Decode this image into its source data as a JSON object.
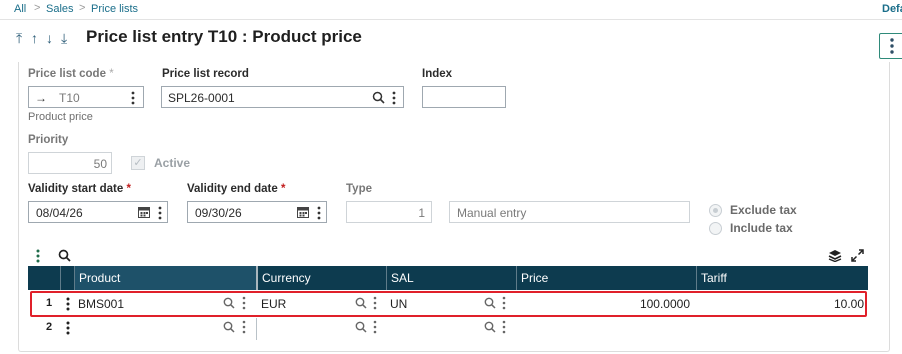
{
  "breadcrumb": {
    "items": [
      "All",
      "Sales",
      "Price lists"
    ],
    "separator": ">",
    "right_label": "Default"
  },
  "header": {
    "title": "Price list entry T10 : Product price",
    "nav": [
      "⤒",
      "↑",
      "↓",
      "⤓"
    ],
    "actions_icon": "kebab-icon"
  },
  "form": {
    "price_list_code": {
      "label": "Price list code",
      "value": "T10",
      "arrow": "→",
      "description": "Product price"
    },
    "price_list_record": {
      "label": "Price list record",
      "value": "SPL26-0001"
    },
    "index": {
      "label": "Index",
      "value": ""
    },
    "priority": {
      "label": "Priority",
      "value": "50"
    },
    "active": {
      "label": "Active",
      "checked": true
    },
    "validity_start": {
      "label": "Validity start date",
      "value": "08/04/26"
    },
    "validity_end": {
      "label": "Validity end date",
      "value": "09/30/26"
    },
    "type": {
      "label": "Type",
      "value": "1",
      "description": "Manual entry"
    },
    "tax": {
      "options": [
        "Exclude tax",
        "Include tax"
      ],
      "selected": "Exclude tax"
    }
  },
  "grid": {
    "columns": [
      "Product",
      "Currency",
      "SAL",
      "Price",
      "Tariff"
    ],
    "rows": [
      {
        "num": "1",
        "product": "BMS001",
        "currency": "EUR",
        "sal": "UN",
        "price": "100.0000",
        "tariff": "10.00"
      },
      {
        "num": "2",
        "product": "",
        "currency": "",
        "sal": "",
        "price": "",
        "tariff": ""
      }
    ]
  },
  "colors": {
    "accent": "#1a6e8a",
    "grid_header": "#0d3b4f",
    "required": "#c21d1d",
    "highlight": "#e0202a"
  }
}
